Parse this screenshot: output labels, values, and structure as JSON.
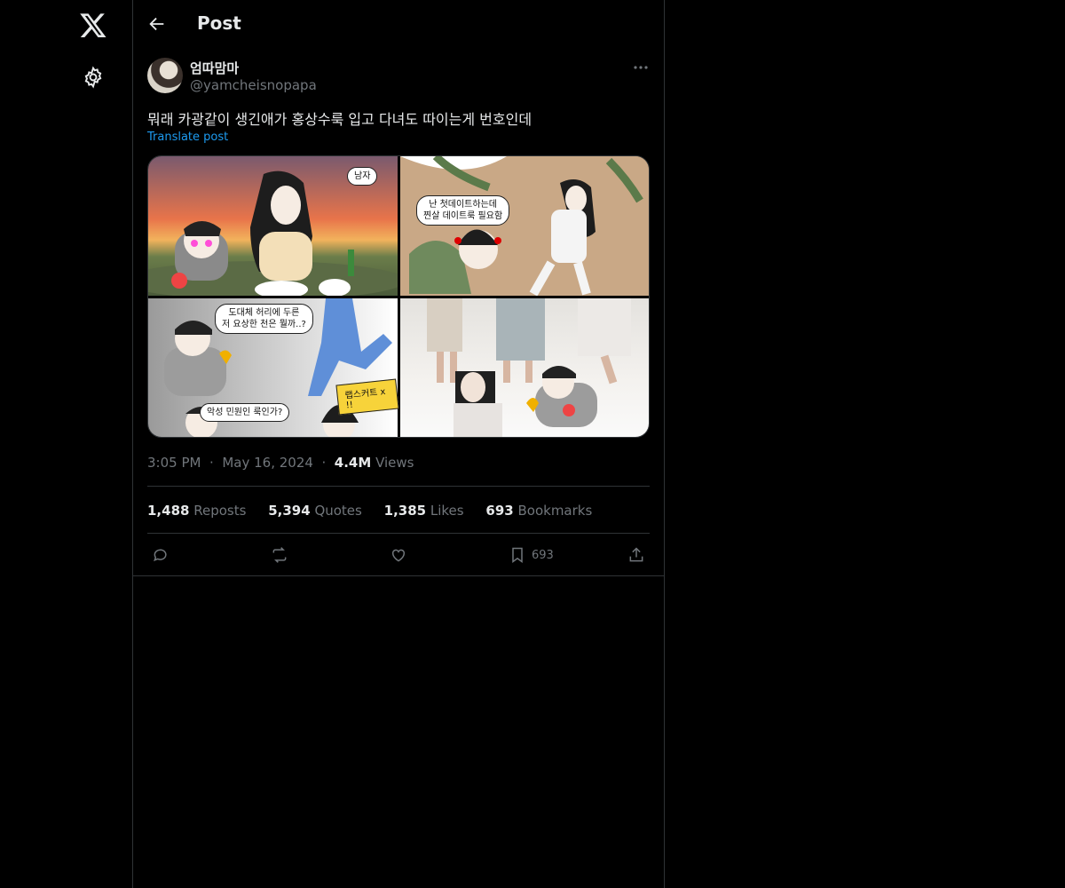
{
  "header": {
    "title": "Post"
  },
  "author": {
    "display_name": "엄따맘마",
    "handle": "@yamcheisnopapa"
  },
  "post": {
    "text": "뭐래 카광같이 생긴애가 홍상수룩 입고 다녀도 따이는게 번호인데",
    "translate_label": "Translate post",
    "time": "3:05 PM",
    "date": "May 16, 2024",
    "views_count": "4.4M",
    "views_label": "Views"
  },
  "media": {
    "panel1_bubble": "남자",
    "panel2_bubble": "난 첫데이트하는데\n찐살 데이트룩 필요함",
    "panel3_bubble_top": "도대체 허리에 두른\n저 요상한 천은 뭘까..?",
    "panel3_burst": "랩스커트 x !!",
    "panel3_bubble_bottom": "악성 민원인 룩인가?"
  },
  "stats": {
    "reposts_count": "1,488",
    "reposts_label": "Reposts",
    "quotes_count": "5,394",
    "quotes_label": "Quotes",
    "likes_count": "1,385",
    "likes_label": "Likes",
    "bookmarks_count": "693",
    "bookmarks_label": "Bookmarks"
  },
  "actions": {
    "bookmark_count": "693"
  },
  "icons": [
    "x-logo-icon",
    "settings-gear-icon",
    "back-arrow-icon",
    "more-icon",
    "reply-icon",
    "repost-icon",
    "like-icon",
    "bookmark-icon",
    "share-icon"
  ]
}
